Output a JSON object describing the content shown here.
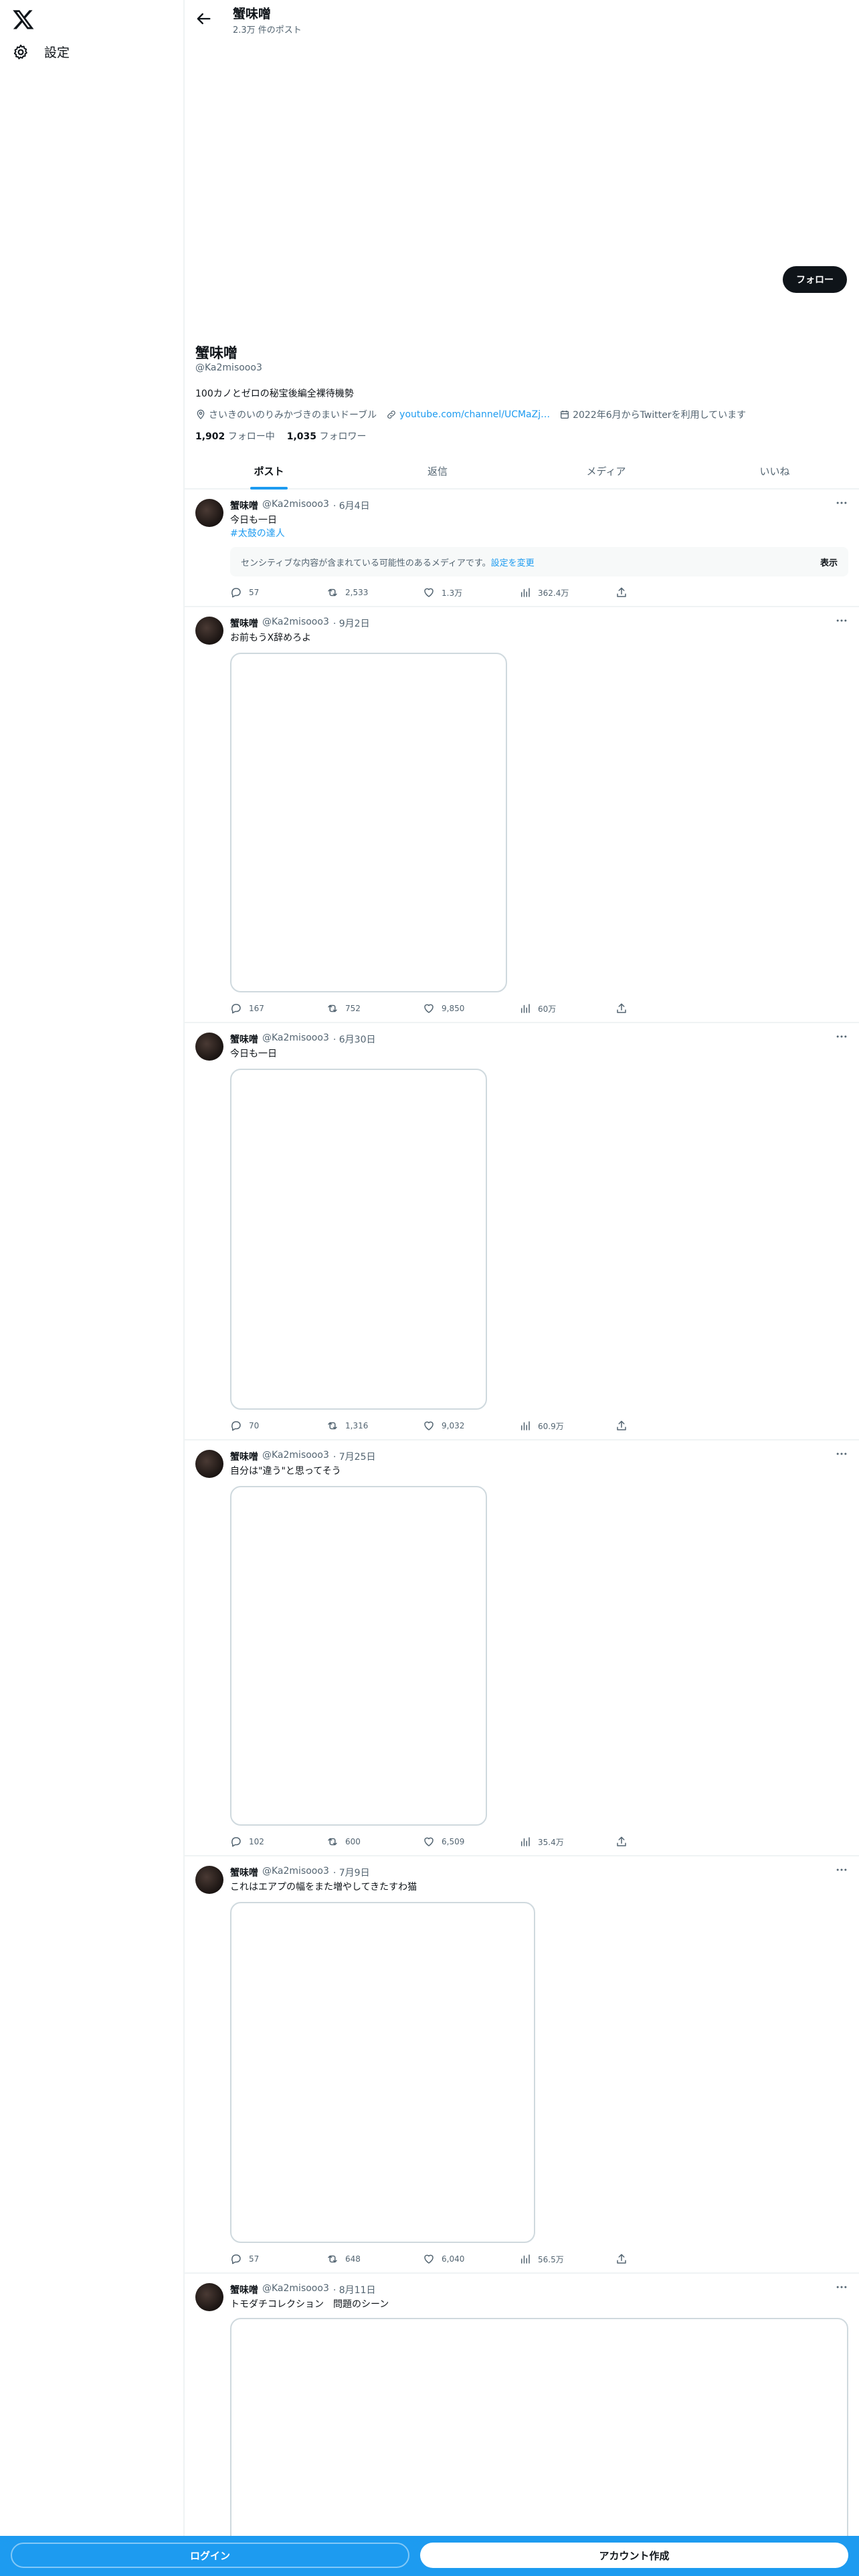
{
  "sidebar": {
    "logo_icon": "x-logo-icon",
    "settings_label": "設定"
  },
  "header": {
    "name": "蟹味噌",
    "post_count": "2.3万 件のポスト"
  },
  "profile": {
    "follow_label": "フォロー",
    "name": "蟹味噌",
    "handle": "@Ka2misooo3",
    "bio": "100カノとゼロの秘宝後編全裸待機勢",
    "location": "さいきのいのりみかづきのまいドーブル",
    "website": "youtube.com/channel/UCMaZj…",
    "joined": "2022年6月からTwitterを利用しています",
    "following_count": "1,902",
    "following_label": "フォロー中",
    "followers_count": "1,035",
    "followers_label": "フォロワー"
  },
  "tabs": [
    {
      "label": "ポスト",
      "active": true
    },
    {
      "label": "返信",
      "active": false
    },
    {
      "label": "メディア",
      "active": false
    },
    {
      "label": "いいね",
      "active": false
    }
  ],
  "posts": [
    {
      "name": "蟹味噌",
      "handle": "@Ka2misooo3",
      "date": "· 6月4日",
      "text": "今日も一日",
      "hashtag": "#太鼓の達人",
      "sensitive_text": "センシティブな内容が含まれている可能性のあるメディアです。",
      "sensitive_link": "設定を変更",
      "sensitive_show": "表示",
      "replies": "57",
      "reposts": "2,533",
      "likes": "1.3万",
      "views": "362.4万"
    },
    {
      "name": "蟹味噌",
      "handle": "@Ka2misooo3",
      "date": "· 9月2日",
      "text": "お前もうX辞めろよ",
      "replies": "167",
      "reposts": "752",
      "likes": "9,850",
      "views": "60万"
    },
    {
      "name": "蟹味噌",
      "handle": "@Ka2misooo3",
      "date": "· 6月30日",
      "text": "今日も一日",
      "replies": "70",
      "reposts": "1,316",
      "likes": "9,032",
      "views": "60.9万"
    },
    {
      "name": "蟹味噌",
      "handle": "@Ka2misooo3",
      "date": "· 7月25日",
      "text": "自分は\"違う\"と思ってそう",
      "replies": "102",
      "reposts": "600",
      "likes": "6,509",
      "views": "35.4万"
    },
    {
      "name": "蟹味噌",
      "handle": "@Ka2misooo3",
      "date": "· 7月9日",
      "text": "これはエアプの幅をまた増やしてきたすわ猫",
      "replies": "57",
      "reposts": "648",
      "likes": "6,040",
      "views": "56.5万"
    },
    {
      "name": "蟹味噌",
      "handle": "@Ka2misooo3",
      "date": "· 8月11日",
      "text": "トモダチコレクション　問題のシーン"
    }
  ],
  "bottom": {
    "login_label": "ログイン",
    "signup_label": "アカウント作成"
  },
  "colors": {
    "accent": "#1d9bf0",
    "text": "#0f1419",
    "muted": "#536471",
    "border": "#eff3f4"
  }
}
